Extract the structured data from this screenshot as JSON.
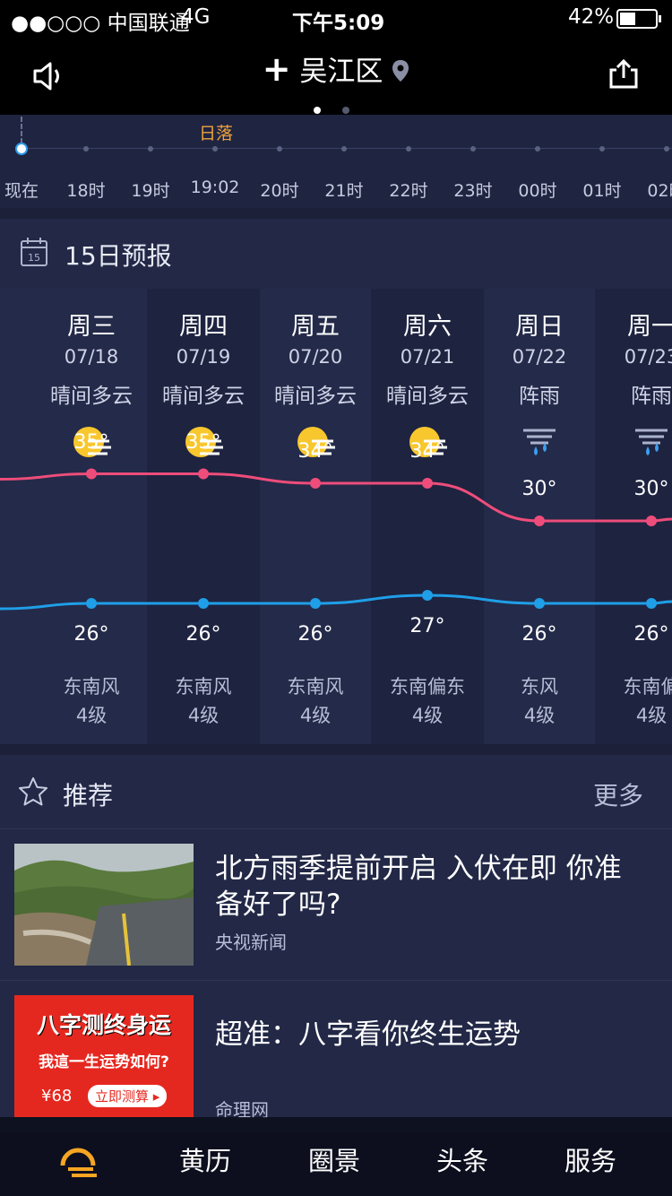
{
  "status_bar": {
    "carrier": "●●○○○ 中国联通",
    "network": "4G",
    "time": "下午5:09",
    "battery": "42%"
  },
  "header": {
    "city": "吴江区"
  },
  "hourly": {
    "sunset_label": "日落",
    "hours": [
      "现在",
      "18时",
      "19时",
      "19:02",
      "20时",
      "21时",
      "22时",
      "23时",
      "00时",
      "01时",
      "02时"
    ]
  },
  "forecast": {
    "title": "15日预报",
    "calendar_day": "15",
    "days": [
      {
        "weekday": "周三",
        "date": "07/18",
        "condition": "晴间多云",
        "icon": "partly-cloudy-icon",
        "high": "35°",
        "low": "26°",
        "wind": "东南风",
        "level": "4级"
      },
      {
        "weekday": "周四",
        "date": "07/19",
        "condition": "晴间多云",
        "icon": "partly-cloudy-icon",
        "high": "35°",
        "low": "26°",
        "wind": "东南风",
        "level": "4级"
      },
      {
        "weekday": "周五",
        "date": "07/20",
        "condition": "晴间多云",
        "icon": "partly-cloudy-icon",
        "high": "34°",
        "low": "26°",
        "wind": "东南风",
        "level": "4级"
      },
      {
        "weekday": "周六",
        "date": "07/21",
        "condition": "晴间多云",
        "icon": "partly-cloudy-icon",
        "high": "34°",
        "low": "27°",
        "wind": "东南偏东",
        "level": "4级"
      },
      {
        "weekday": "周日",
        "date": "07/22",
        "condition": "阵雨",
        "icon": "shower-icon",
        "high": "30°",
        "low": "26°",
        "wind": "东风",
        "level": "4级"
      },
      {
        "weekday": "周一",
        "date": "07/23",
        "condition": "阵雨",
        "icon": "shower-icon",
        "high": "30°",
        "low": "26°",
        "wind": "东南偏",
        "level": "4级"
      }
    ],
    "high_color": "#ee4d7b",
    "low_color": "#1f9fe8"
  },
  "recommended": {
    "title": "推荐",
    "more": "更多",
    "items": [
      {
        "headline": "北方雨季提前开启 入伏在即 你准备好了吗?",
        "source": "央视新闻"
      },
      {
        "headline": "超准：八字看你终生运势",
        "source": "命理网",
        "thumb_title": "八字测终身运",
        "thumb_sub": "我這一生运势如何?",
        "thumb_price": "¥68",
        "thumb_button": "立即测算 ▸"
      }
    ]
  },
  "tabbar": {
    "tabs": [
      "黄历",
      "圈景",
      "头条",
      "服务"
    ]
  }
}
